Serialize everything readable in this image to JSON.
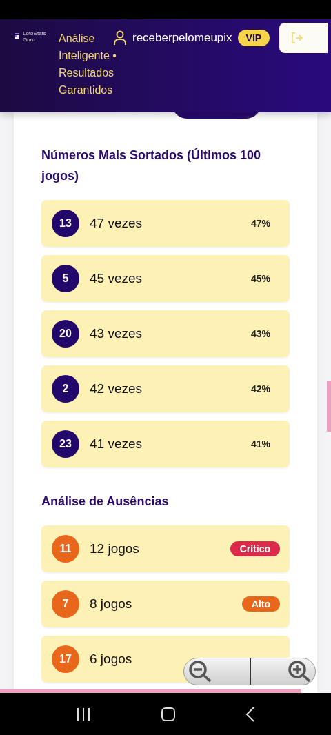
{
  "header": {
    "logo_text": "LotoStats Guru",
    "tagline": "Análise Inteligente • Resultados Garantidos",
    "username": "receberpelomeupix",
    "badge": "VIP"
  },
  "sections": [
    {
      "kind": "frequency",
      "title": "Números Mais Sortados (Últimos 100 jogos)",
      "rows": [
        {
          "number": "13",
          "count": "47 vezes",
          "value": "47%"
        },
        {
          "number": "5",
          "count": "45 vezes",
          "value": "45%"
        },
        {
          "number": "20",
          "count": "43 vezes",
          "value": "43%"
        },
        {
          "number": "2",
          "count": "42 vezes",
          "value": "42%"
        },
        {
          "number": "23",
          "count": "41 vezes",
          "value": "41%"
        }
      ]
    },
    {
      "kind": "absence",
      "title": "Análise de Ausências",
      "rows": [
        {
          "number": "11",
          "count": "12 jogos",
          "badge": {
            "label": "Crítico",
            "color": "#dc2a4a"
          }
        },
        {
          "number": "7",
          "count": "8 jogos",
          "badge": {
            "label": "Alto",
            "color": "#e8671b"
          }
        },
        {
          "number": "17",
          "count": "6 jogos"
        }
      ]
    }
  ]
}
